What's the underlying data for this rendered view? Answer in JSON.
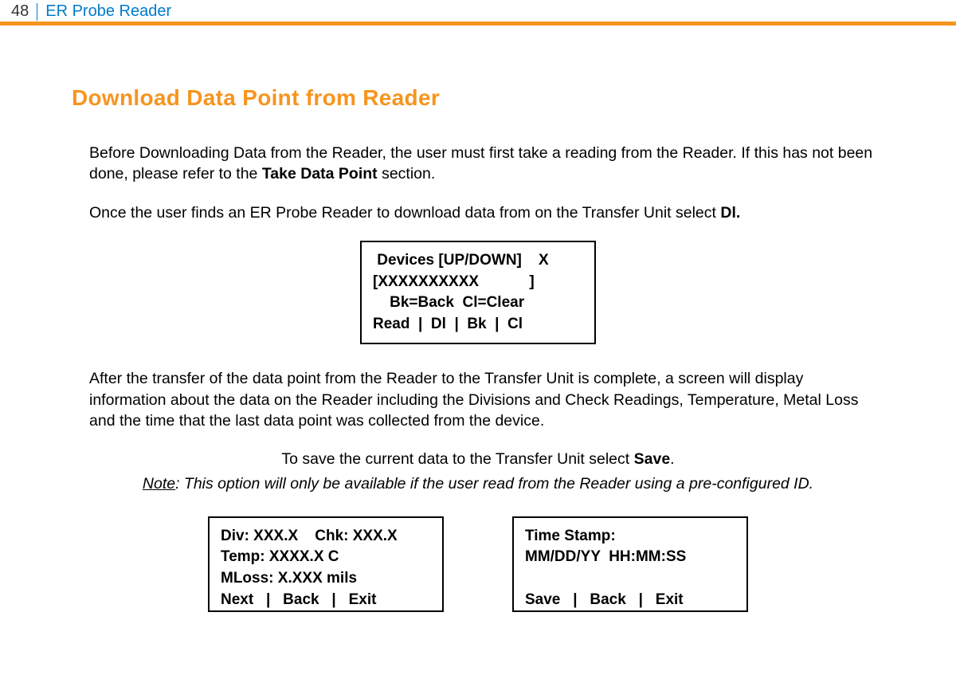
{
  "header": {
    "page_number": "48",
    "title": "ER Probe Reader"
  },
  "section": {
    "title": "Download Data Point from Reader"
  },
  "paragraphs": {
    "p1_part1": "Before Downloading Data from the Reader, the user must first take a reading from the Reader. If this has not been done, please refer to the ",
    "p1_bold": "Take Data Point",
    "p1_part2": " section.",
    "p2_part1": "Once the user finds an ER Probe Reader to download data from on the Transfer Unit select ",
    "p2_bold": "Dl.",
    "p3": "After the transfer of the data point from the Reader to the Transfer Unit is complete, a screen will display information about the data on the Reader including the Divisions and Check Readings, Temperature, Metal Loss and the time that the last data point was collected from the device.",
    "save_line_part1": "To save the current data to the Transfer Unit select ",
    "save_line_bold": "Save",
    "save_line_part2": ".",
    "note_underline": "Note",
    "note_rest": ": This option will only be available if the user read from the Reader using a pre-configured ID."
  },
  "screens": {
    "devices": {
      "l1": " Devices [UP/DOWN]    X",
      "l2": "[XXXXXXXXXX            ]",
      "l3": "    Bk=Back  Cl=Clear",
      "l4": "Read  |  Dl  |  Bk  |  Cl"
    },
    "data": {
      "l1": "Div: XXX.X    Chk: XXX.X",
      "l2": "Temp: XXXX.X C",
      "l3": "MLoss: X.XXX mils",
      "l4": "Next   |   Back   |   Exit"
    },
    "timestamp": {
      "l1": "Time Stamp:",
      "l2": "MM/DD/YY  HH:MM:SS",
      "l3": " ",
      "l4": "Save   |   Back   |   Exit"
    }
  }
}
